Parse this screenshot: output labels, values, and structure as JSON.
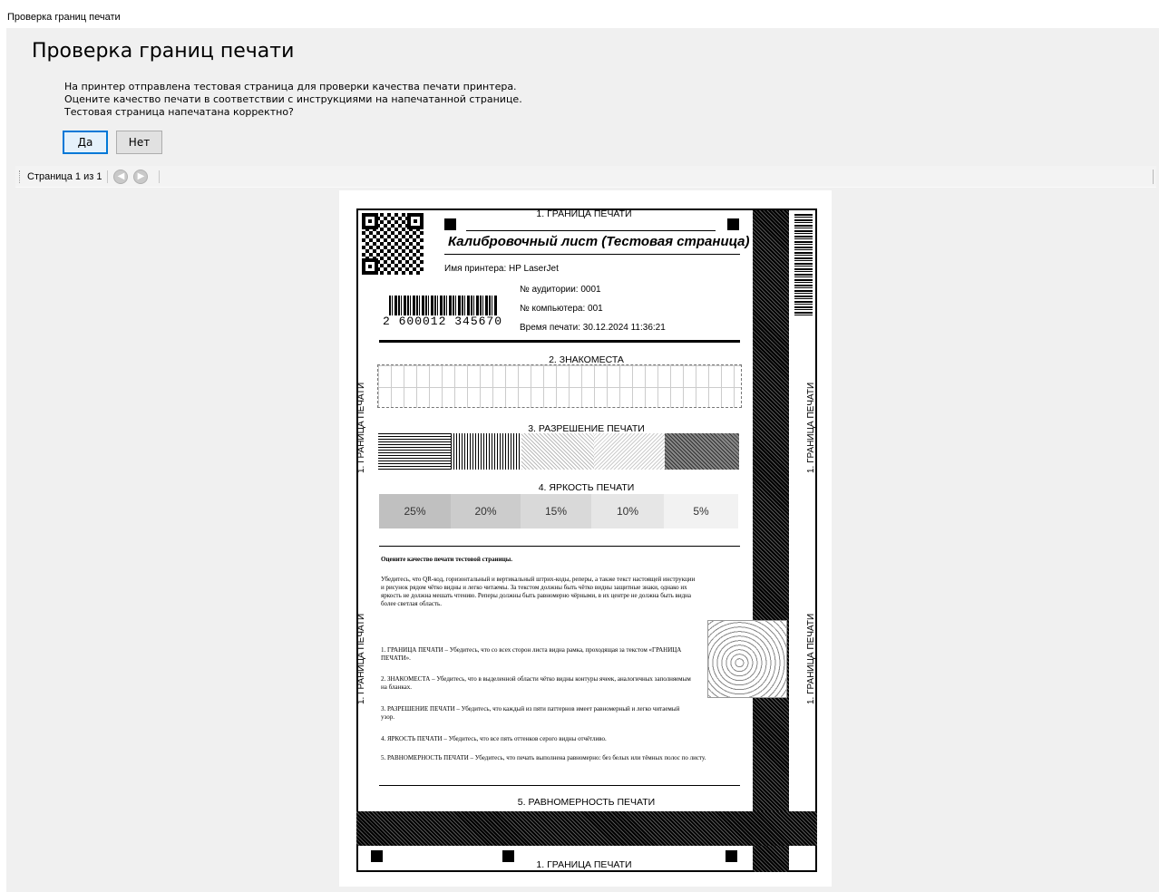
{
  "window": {
    "title": "Проверка границ печати"
  },
  "main": {
    "heading": "Проверка границ печати",
    "description": [
      "На принтер отправлена тестовая страница для проверки качества печати принтера.",
      "Оцените качество печати в соответствии с инструкциями на напечатанной странице.",
      "Тестовая страница напечатана корректно?"
    ],
    "buttons": {
      "yes": "Да",
      "no": "Нет"
    }
  },
  "toolbar": {
    "pager_text": "Страница 1 из 1",
    "prev_icon": "arrow-left-icon",
    "next_icon": "arrow-right-icon"
  },
  "test_page": {
    "border_label": "1. ГРАНИЦА ПЕЧАТИ",
    "title": "Калибровочный лист (Тестовая страница)",
    "printer_name": "Имя принтера: HP LaserJet",
    "room": "№ аудитории: 0001",
    "computer": "№ компьютера: 001",
    "print_time": "Время печати: 30.12.2024 11:36:21",
    "barcode_number": "2 600012 345670",
    "glyphs_label": "2. ЗНАКОМЕСТА",
    "resolution_label": "3. РАЗРЕШЕНИЕ ПЕЧАТИ",
    "brightness_label": "4. ЯРКОСТЬ ПЕЧАТИ",
    "brightness": [
      "25%",
      "20%",
      "15%",
      "10%",
      "5%"
    ],
    "uniformity_label": "5. РАВНОМЕРНОСТЬ ПЕЧАТИ",
    "instr_title": "Оцените качество печати тестовой страницы.",
    "instr_intro": "Убедитесь, что QR-код, горизонтальный и вертикальный штрих-коды, реперы, а также текст настоящей инструкции и рисунок рядом чётко видны и легко читаемы. За текстом должны быть чётко видны защитные знаки, однако их яркость не должна мешать чтению. Реперы должны быть равномерно чёрными, в их центре не должна быть видна более светлая область.",
    "instr_items": [
      "1. ГРАНИЦА ПЕЧАТИ – Убедитесь, что со всех сторон листа видна рамка, проходящая за текстом «ГРАНИЦА ПЕЧАТИ».",
      "2. ЗНАКОМЕСТА – Убедитесь, что в выделенной области чётко видны контуры ячеек, аналогичных заполняемым на бланках.",
      "3. РАЗРЕШЕНИЕ ПЕЧАТИ – Убедитесь, что каждый из пяти паттернов имеет равномерный и легко читаемый узор.",
      "4. ЯРКОСТЬ ПЕЧАТИ – Убедитесь, что все пять оттенков серого видны отчётливо.",
      "5. РАВНОМЕРНОСТЬ ПЕЧАТИ – Убедитесь, что печать выполнена равномерно: без белых или тёмных полос по листу."
    ]
  }
}
